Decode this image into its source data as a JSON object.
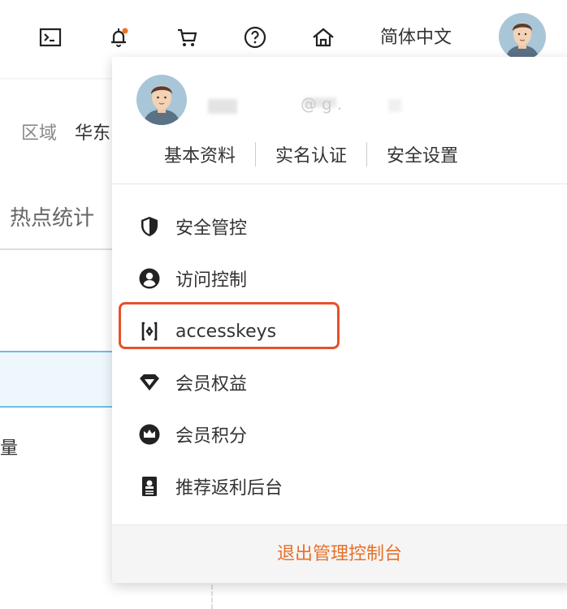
{
  "topbar": {
    "icons": [
      "terminal-icon",
      "bell-icon",
      "cart-icon",
      "help-icon",
      "home-icon"
    ],
    "notification_dot_color": "#f07028",
    "language": "简体中文"
  },
  "background_page": {
    "region_label": "区域",
    "region_value": "华东",
    "hot_stats_tab": "热点统计",
    "amount_label": "量"
  },
  "account_menu": {
    "username": "@g.",
    "quick_links": [
      "基本资料",
      "实名认证",
      "安全设置"
    ],
    "items": [
      {
        "label": "安全管控",
        "icon": "shield-icon"
      },
      {
        "label": "访问控制",
        "icon": "user-circle-icon"
      },
      {
        "label": "accesskeys",
        "icon": "key-bracket-icon"
      },
      {
        "label": "会员权益",
        "icon": "diamond-icon"
      },
      {
        "label": "会员积分",
        "icon": "crown-icon"
      },
      {
        "label": "推荐返利后台",
        "icon": "rebate-document-icon"
      }
    ],
    "highlight_color": "#e8502a",
    "logout": "退出管理控制台",
    "logout_color": "#e8702a"
  }
}
